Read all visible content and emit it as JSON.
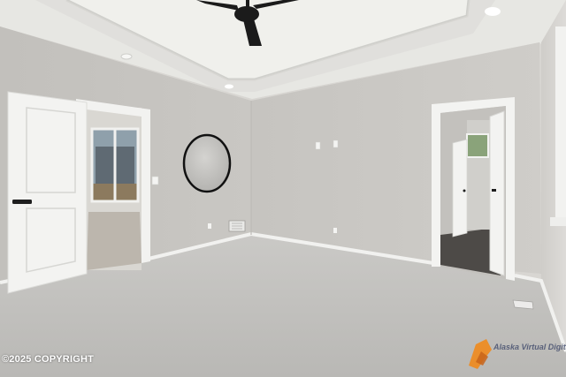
{
  "photo": {
    "description_kind": "empty bedroom interior with tray ceiling, ceiling fan, round wall mirror, two open doorways and grey carpet"
  },
  "watermark": {
    "copyright": "©2025 COPYRIGHT",
    "logo_text": "Alaska Virtual Digital Photo"
  },
  "palette": {
    "wall": "#c9c7c3",
    "ceiling": "#eeeeea",
    "carpet": "#c3c2bf",
    "trim": "#f4f4f2",
    "door": "#f3f3f1",
    "fan": "#1b1b1b",
    "logo_accent": "#f08a1c"
  }
}
